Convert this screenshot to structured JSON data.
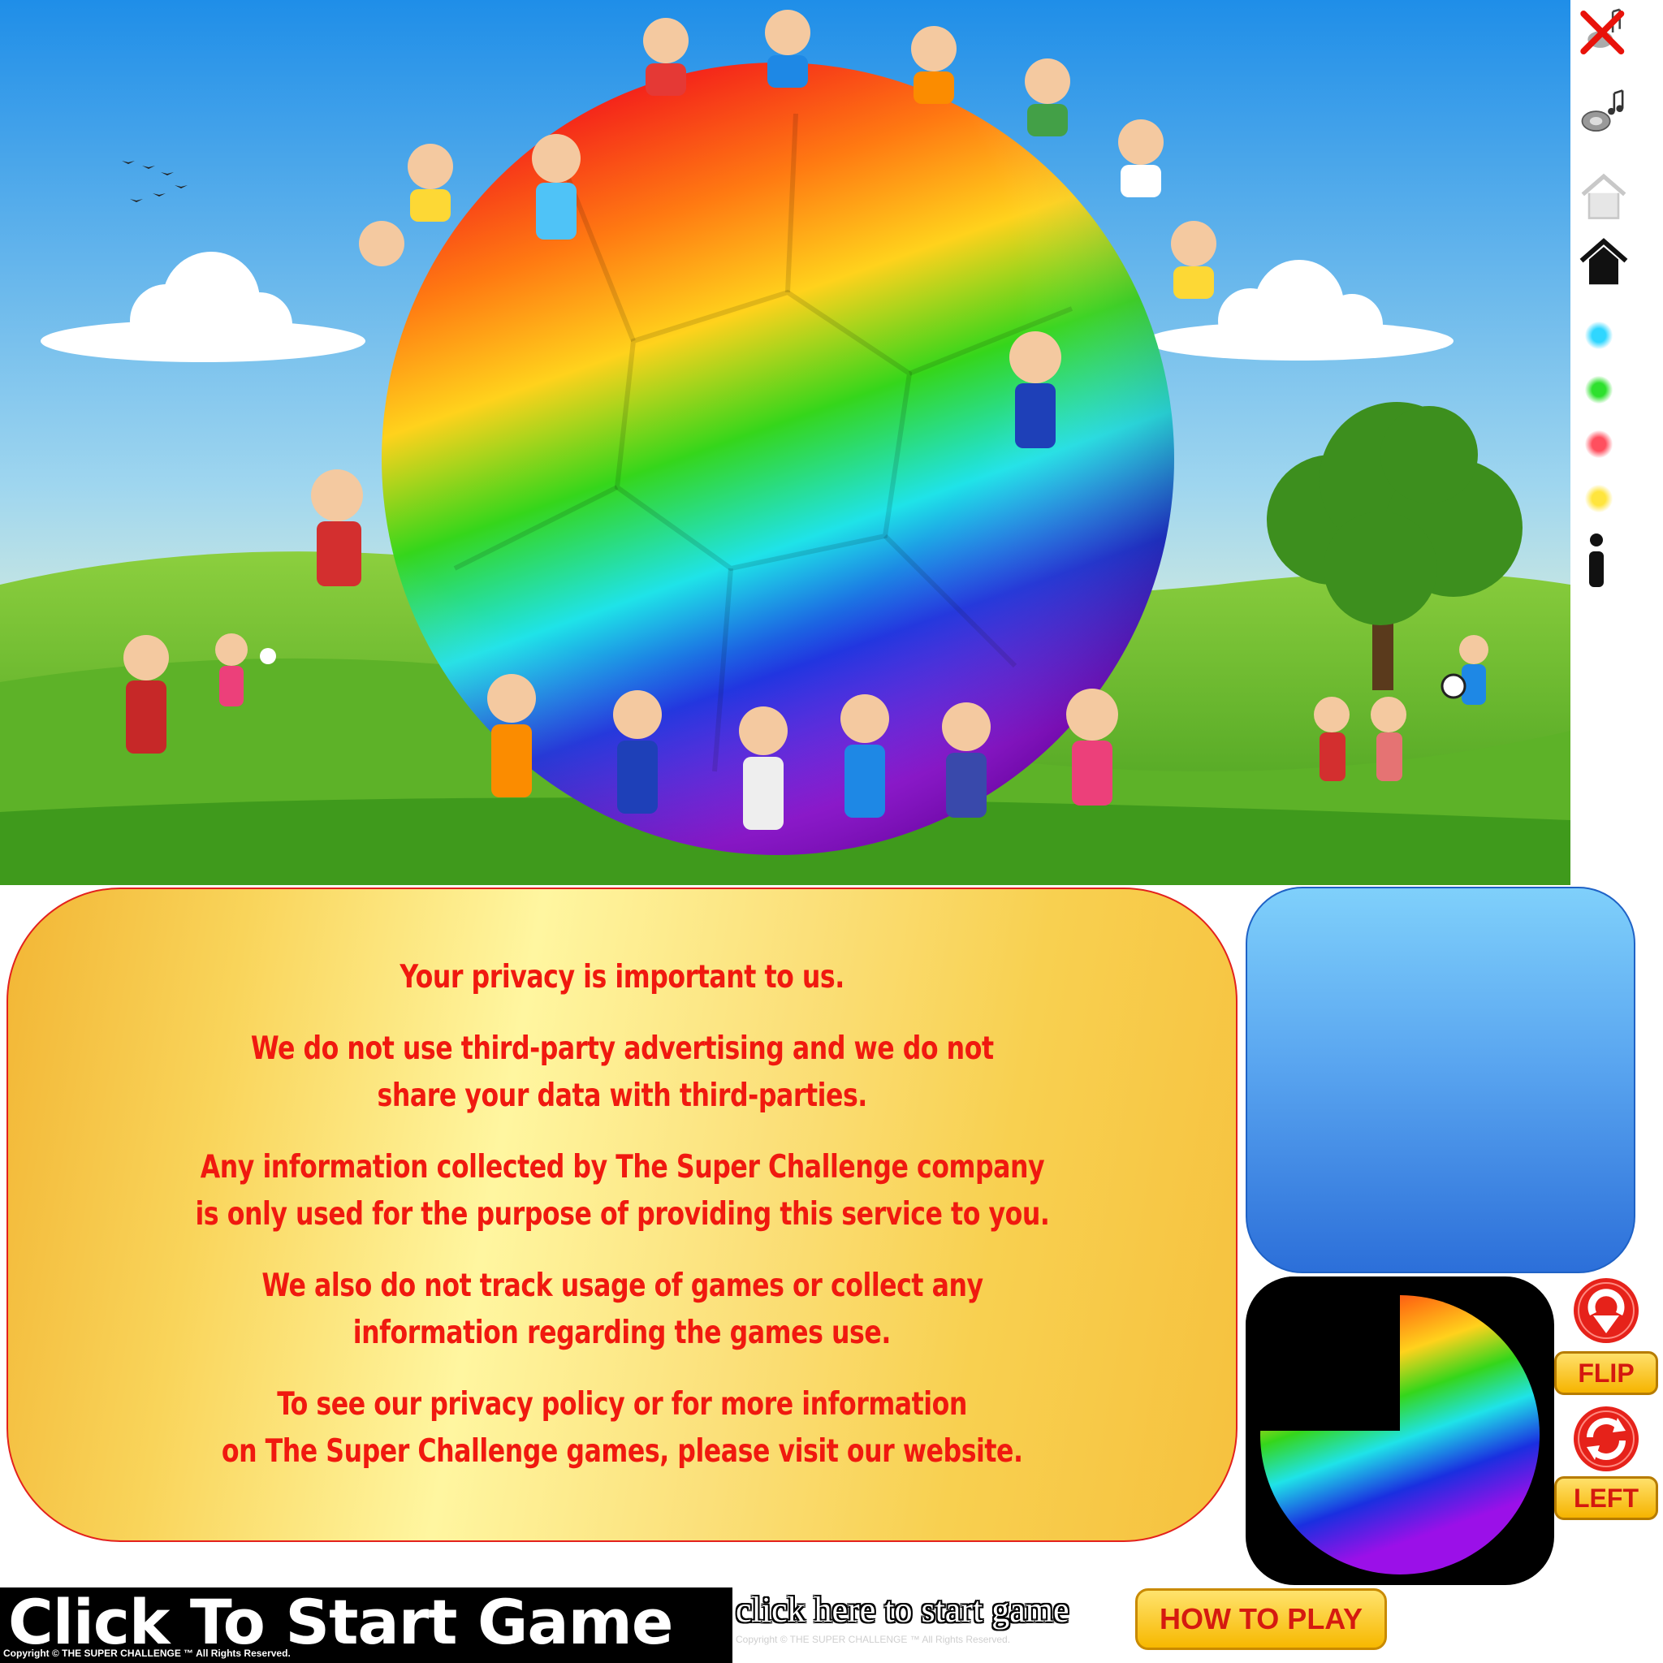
{
  "sidebar": {
    "icons": [
      "sound-off-icon",
      "music-icon",
      "home-outline-icon",
      "home-icon",
      "info-icon"
    ],
    "color_dots": [
      "#2fd6ff",
      "#2ee02e",
      "#ff4f5e",
      "#ffe53d"
    ]
  },
  "privacy": {
    "line1": "Your privacy is important to us.",
    "line2a": "We do not use third-party advertising and we do not",
    "line2b": "share your data with third-parties.",
    "line3a": "Any information collected by The Super Challenge company",
    "line3b": "is only used for the purpose of providing this service to you.",
    "line4a": "We also do not track usage of games or collect any",
    "line4b": "information regarding the games use.",
    "line5a": "To see our privacy policy or for more information",
    "line5b": "on The Super Challenge games, please visit our website."
  },
  "controls": {
    "flip_label": "FLIP",
    "left_label": "LEFT"
  },
  "bottom": {
    "start_title": "Click To Start Game",
    "copyright": "Copyright © THE SUPER CHALLENGE ™ All Rights Reserved.",
    "start_link": "click here to start game",
    "faint_copyright": "Copyright © THE SUPER CHALLENGE ™ All Rights Reserved.",
    "how_to_play": "HOW TO PLAY"
  }
}
